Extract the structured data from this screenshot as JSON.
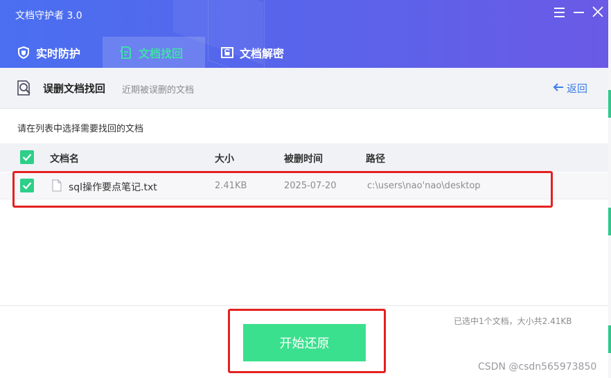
{
  "app": {
    "title": "文档守护者 3.0"
  },
  "tabs": [
    {
      "label": "实时防护",
      "active": false
    },
    {
      "label": "文档找回",
      "active": true
    },
    {
      "label": "文档解密",
      "active": false
    }
  ],
  "subheader": {
    "title": "误删文档找回",
    "description": "近期被误删的文档",
    "back_label": "返回"
  },
  "instruction": "请在列表中选择需要找回的文档",
  "table": {
    "headers": [
      "文档名",
      "大小",
      "被删时间",
      "路径"
    ],
    "rows": [
      {
        "checked": true,
        "name": "sql操作要点笔记.txt",
        "size": "2.41KB",
        "deleted_time": "2025-07-20",
        "path": "c:\\users\\nao'nao\\desktop"
      }
    ]
  },
  "footer": {
    "summary": "已选中1个文档，大小共2.41KB",
    "restore_button": "开始还原"
  },
  "watermark": "CSDN @csdn565973850",
  "colors": {
    "accent_green": "#3be08e",
    "header_blue": "#4a6ff0",
    "link_blue": "#3d7de8",
    "highlight_red": "#e52020"
  }
}
